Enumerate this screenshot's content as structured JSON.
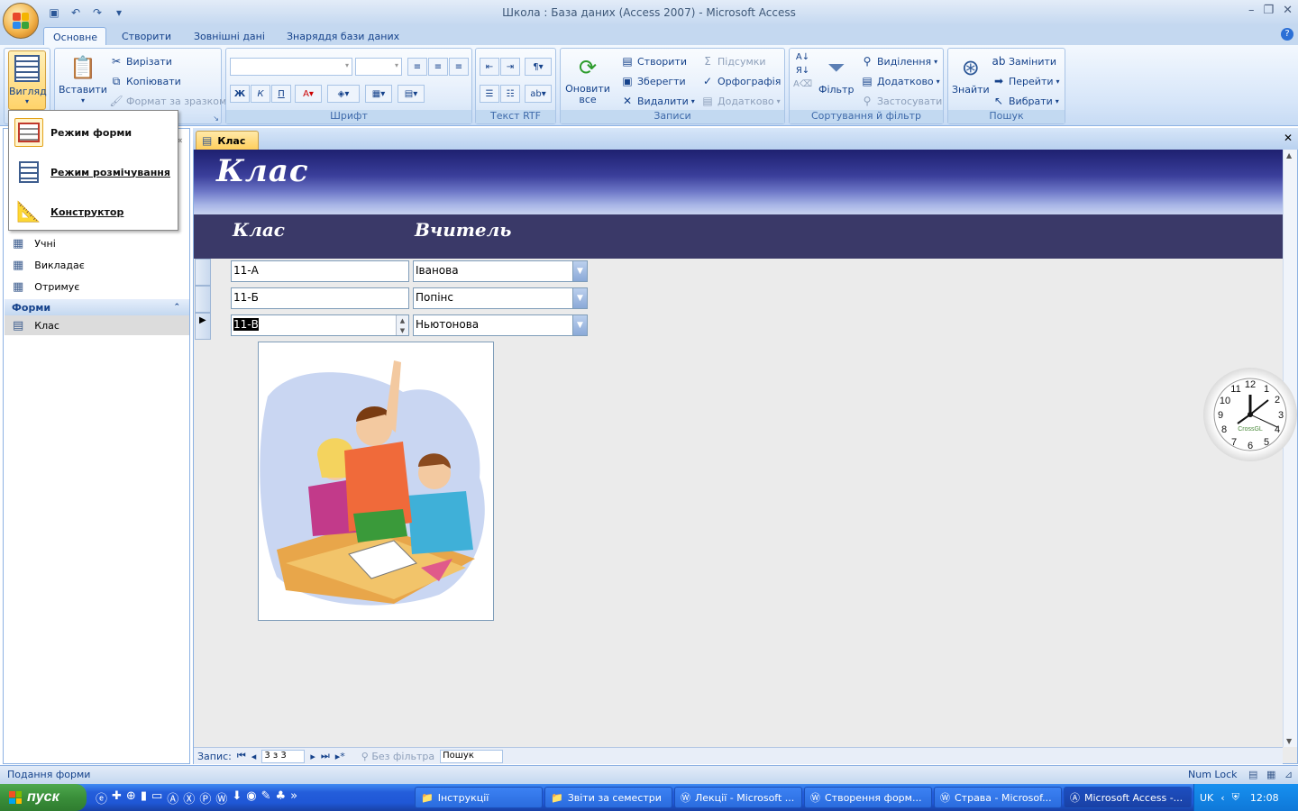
{
  "window": {
    "title": "Школа : База даних (Access 2007) - Microsoft Access"
  },
  "ribbon": {
    "tabs": [
      "Основне",
      "Створити",
      "Зовнішні дані",
      "Знаряддя бази даних"
    ],
    "groups": {
      "views": {
        "view_label": "Вигляд"
      },
      "clipboard": {
        "paste": "Вставити",
        "cut": "Вирізати",
        "copy": "Копіювати",
        "format_painter": "Формат за зразком"
      },
      "font": {
        "caption": "Шрифт"
      },
      "rtf": {
        "caption": "Текст RTF"
      },
      "records": {
        "caption": "Записи",
        "refresh": "Оновити все",
        "new": "Створити",
        "save": "Зберегти",
        "delete": "Видалити",
        "totals": "Підсумки",
        "spelling": "Орфографія",
        "more": "Додатково"
      },
      "sort_filter": {
        "caption": "Сортування й фільтр",
        "filter": "Фільтр",
        "selection": "Виділення",
        "advanced": "Додатково",
        "toggle": "Застосувати"
      },
      "find": {
        "caption": "Пошук",
        "find": "Знайти",
        "replace": "Замінити",
        "goto": "Перейти",
        "select": "Вибрати"
      }
    }
  },
  "view_menu": {
    "items": [
      {
        "label": "Режим форми"
      },
      {
        "label": "Режим розмічування"
      },
      {
        "label": "Конструктор"
      }
    ]
  },
  "nav": {
    "tables": [
      "Учні",
      "Викладає",
      "Отримує"
    ],
    "forms_group": "Форми",
    "forms": [
      "Клас"
    ]
  },
  "document": {
    "tab": "Клас",
    "form_title": "Клас",
    "col_class": "Клас",
    "col_teacher": "Вчитель",
    "rows": [
      {
        "class": "11-А",
        "teacher": "Іванова"
      },
      {
        "class": "11-Б",
        "teacher": "Попінс"
      },
      {
        "class": "11-В",
        "teacher": "Ньютонова"
      }
    ]
  },
  "record_nav": {
    "label": "Запис:",
    "current": "3 з 3",
    "filter": "Без фільтра",
    "search": "Пошук"
  },
  "status": {
    "left": "Подання форми",
    "numlock": "Num Lock"
  },
  "clock_widget": {
    "brand": "CrossGL"
  },
  "taskbar": {
    "start": "пуск",
    "items": [
      "Інструкції",
      "Звіти за семестри",
      "Лекції - Microsoft ...",
      "Створення форм...",
      "Страва - Microsof...",
      "Microsoft Access -..."
    ],
    "lang": "UK",
    "time": "12:08"
  }
}
